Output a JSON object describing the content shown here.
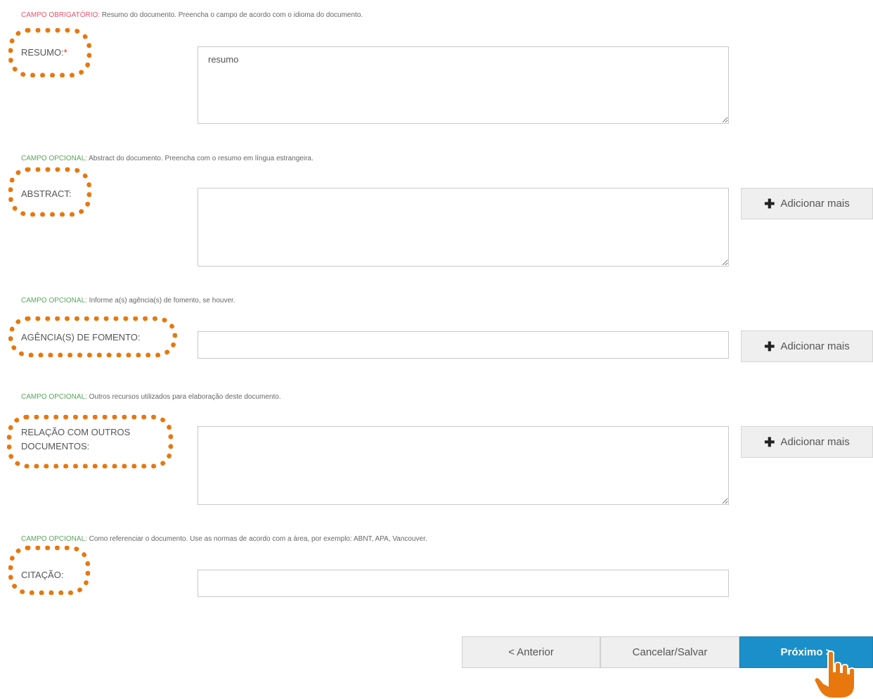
{
  "fields": {
    "resumo": {
      "tag": "CAMPO OBRIGATÓRIO:",
      "hint": " Resumo do documento. Preencha o campo de acordo com o idioma do documento.",
      "label": "RESUMO:",
      "required_mark": "*",
      "value": "resumo"
    },
    "abstract": {
      "tag": "CAMPO OPCIONAL:",
      "hint": " Abstract do documento. Preencha com o resumo em língua estrangeira.",
      "label": "ABSTRACT:",
      "value": "",
      "add_label": "Adicionar mais"
    },
    "agencias": {
      "tag": "CAMPO OPCIONAL:",
      "hint": " Informe a(s) agência(s) de fomento, se houver.",
      "label": "AGÊNCIA(S) DE FOMENTO:",
      "value": "",
      "add_label": "Adicionar mais"
    },
    "relacao": {
      "tag": "CAMPO OPCIONAL:",
      "hint": " Outros recursos utilizados para elaboração deste documento.",
      "label_line1": "RELAÇÃO COM OUTROS",
      "label_line2": "DOCUMENTOS:",
      "value": "",
      "add_label": "Adicionar mais"
    },
    "citacao": {
      "tag": "CAMPO OPCIONAL:",
      "hint": " Como referenciar o documento. Use as normas de acordo com a área, por exemplo: ABNT, APA, Vancouver.",
      "label": "CITAÇÃO:",
      "value": ""
    }
  },
  "nav": {
    "previous": "< Anterior",
    "cancel_save": "Cancelar/Salvar",
    "next": "Próximo >"
  },
  "colors": {
    "required_tag": "#e8536b",
    "optional_tag": "#5aa55a",
    "highlight": "#e8770e",
    "primary": "#1b8fc9"
  },
  "icons": [
    "plus-icon",
    "hand-pointer-icon"
  ]
}
